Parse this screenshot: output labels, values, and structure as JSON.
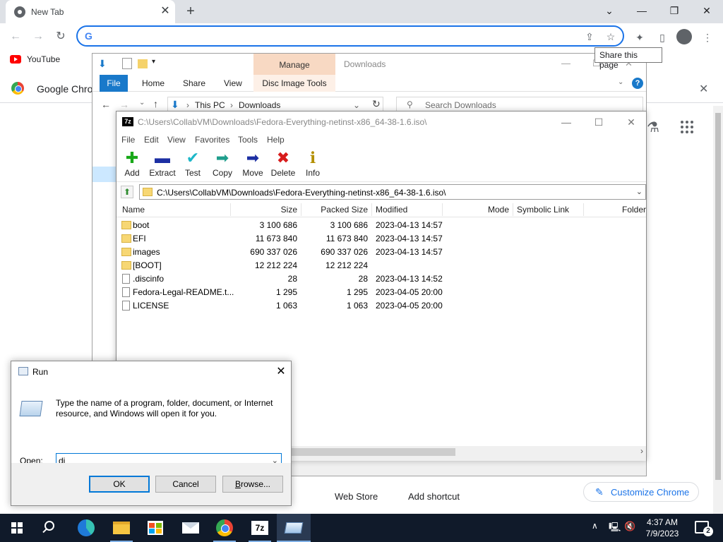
{
  "chrome": {
    "tab_title": "New Tab",
    "tab_close": "✕",
    "new_tab": "+",
    "omnibox_value": "",
    "tooltip": "Share this page",
    "bookmark_youtube": "YouTube",
    "infobar_text": "Google Chrome",
    "ntp_webstore": "Web Store",
    "ntp_add_shortcut": "Add shortcut",
    "customize": "Customize Chrome"
  },
  "explorer": {
    "manage_tab": "Manage",
    "window_title": "Downloads",
    "ribbon_tabs": [
      "File",
      "Home",
      "Share",
      "View",
      "Disc Image Tools"
    ],
    "path": [
      "This PC",
      "Downloads"
    ],
    "search_placeholder": "Search Downloads"
  },
  "sevenzip": {
    "title": "C:\\Users\\CollabVM\\Downloads\\Fedora-Everything-netinst-x86_64-38-1.6.iso\\",
    "app_icon": "7z",
    "menu": [
      "File",
      "Edit",
      "View",
      "Favorites",
      "Tools",
      "Help"
    ],
    "tools": [
      {
        "label": "Add",
        "icon": "add-icon",
        "glyph": "✚",
        "color": "#18a818"
      },
      {
        "label": "Extract",
        "icon": "extract-icon",
        "glyph": "▬",
        "color": "#1c2fa3"
      },
      {
        "label": "Test",
        "icon": "test-icon",
        "glyph": "✔",
        "color": "#1db7c8"
      },
      {
        "label": "Copy",
        "icon": "copy-icon",
        "glyph": "➡",
        "color": "#1f9e8c"
      },
      {
        "label": "Move",
        "icon": "move-icon",
        "glyph": "➡",
        "color": "#1c2fa3"
      },
      {
        "label": "Delete",
        "icon": "delete-icon",
        "glyph": "✖",
        "color": "#d81c1c"
      },
      {
        "label": "Info",
        "icon": "info-icon",
        "glyph": "ℹ",
        "color": "#b38f00"
      }
    ],
    "path_value": "C:\\Users\\CollabVM\\Downloads\\Fedora-Everything-netinst-x86_64-38-1.6.iso\\",
    "columns": [
      "Name",
      "Size",
      "Packed Size",
      "Modified",
      "Mode",
      "Symbolic Link",
      "Folder"
    ],
    "rows": [
      {
        "type": "folder",
        "name": "boot",
        "size": "3 100 686",
        "packed": "3 100 686",
        "modified": "2023-04-13 14:57"
      },
      {
        "type": "folder",
        "name": "EFI",
        "size": "11 673 840",
        "packed": "11 673 840",
        "modified": "2023-04-13 14:57"
      },
      {
        "type": "folder",
        "name": "images",
        "size": "690 337 026",
        "packed": "690 337 026",
        "modified": "2023-04-13 14:57"
      },
      {
        "type": "folder",
        "name": "[BOOT]",
        "size": "12 212 224",
        "packed": "12 212 224",
        "modified": ""
      },
      {
        "type": "file",
        "name": ".discinfo",
        "size": "28",
        "packed": "28",
        "modified": "2023-04-13 14:52"
      },
      {
        "type": "file",
        "name": "Fedora-Legal-README.t...",
        "size": "1 295",
        "packed": "1 295",
        "modified": "2023-04-05 20:00"
      },
      {
        "type": "file",
        "name": "LICENSE",
        "size": "1 063",
        "packed": "1 063",
        "modified": "2023-04-05 20:00"
      }
    ]
  },
  "run": {
    "title": "Run",
    "description": "Type the name of a program, folder, document, or Internet resource, and Windows will open it for you.",
    "open_label_u": "O",
    "open_label_rest": "pen:",
    "input_value": "di",
    "ok": "OK",
    "cancel": "Cancel",
    "browse_u": "B",
    "browse_rest": "rowse..."
  },
  "taskbar": {
    "time": "4:37 AM",
    "date": "7/9/2023",
    "notification_count": "2",
    "sevenzip_label": "7z"
  }
}
